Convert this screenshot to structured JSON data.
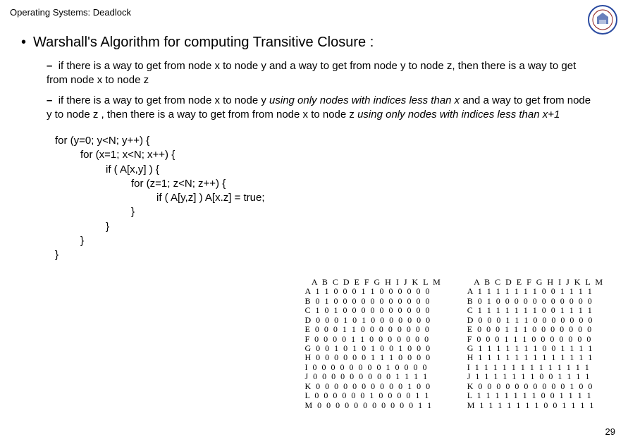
{
  "header": "Operating Systems: Deadlock",
  "title": "Warshall's Algorithm for computing Transitive Closure :",
  "bullets": [
    {
      "pre": "if there is a way to get from node x to node y and a way to get from node y to node z, then there is a way to get from node x to node z",
      "italic": "",
      "post": ""
    },
    {
      "pre": "if there is a way to get from node x to node y ",
      "italic1": "using only nodes with indices less than x",
      "mid": " and a way to get from node y to node z , then there is a way to get from from node x to node z ",
      "italic2": "using only nodes with indices less than x+1",
      "post": ""
    }
  ],
  "code": {
    "l1": "for (y=0; y<N; y++) {",
    "l2": "for (x=1; x<N; x++) {",
    "l3": "if ( A[x,y] ) {",
    "l4": "for (z=1; z<N; z++) {",
    "l5": "if ( A[y,z] ) A[x.z] = true;",
    "l6": "}",
    "l7": "}",
    "l8": "}",
    "l9": "}"
  },
  "chart_data": [
    {
      "type": "table",
      "title": "Adjacency matrix (before)",
      "columns": [
        "A",
        "B",
        "C",
        "D",
        "E",
        "F",
        "G",
        "H",
        "I",
        "J",
        "K",
        "L",
        "M"
      ],
      "rows": [
        "A",
        "B",
        "C",
        "D",
        "E",
        "F",
        "G",
        "H",
        "I",
        "J",
        "K",
        "L",
        "M"
      ],
      "values": [
        [
          1,
          1,
          0,
          0,
          0,
          1,
          1,
          0,
          0,
          0,
          0,
          0,
          0
        ],
        [
          0,
          1,
          0,
          0,
          0,
          0,
          0,
          0,
          0,
          0,
          0,
          0,
          0
        ],
        [
          1,
          0,
          1,
          0,
          0,
          0,
          0,
          0,
          0,
          0,
          0,
          0,
          0
        ],
        [
          0,
          0,
          0,
          1,
          0,
          1,
          0,
          0,
          0,
          0,
          0,
          0,
          0
        ],
        [
          0,
          0,
          0,
          1,
          1,
          0,
          0,
          0,
          0,
          0,
          0,
          0,
          0
        ],
        [
          0,
          0,
          0,
          0,
          1,
          1,
          0,
          0,
          0,
          0,
          0,
          0,
          0
        ],
        [
          0,
          0,
          1,
          0,
          1,
          0,
          1,
          0,
          0,
          1,
          0,
          0,
          0
        ],
        [
          0,
          0,
          0,
          0,
          0,
          0,
          1,
          1,
          1,
          0,
          0,
          0,
          0
        ],
        [
          0,
          0,
          0,
          0,
          0,
          0,
          0,
          0,
          1,
          0,
          0,
          0,
          0
        ],
        [
          0,
          0,
          0,
          0,
          0,
          0,
          0,
          0,
          0,
          1,
          1,
          1,
          1
        ],
        [
          0,
          0,
          0,
          0,
          0,
          0,
          0,
          0,
          0,
          0,
          1,
          0,
          0
        ],
        [
          0,
          0,
          0,
          0,
          0,
          0,
          1,
          0,
          0,
          0,
          0,
          1,
          1
        ],
        [
          0,
          0,
          0,
          0,
          0,
          0,
          0,
          0,
          0,
          0,
          0,
          1,
          1
        ]
      ]
    },
    {
      "type": "table",
      "title": "Transitive closure (after)",
      "columns": [
        "A",
        "B",
        "C",
        "D",
        "E",
        "F",
        "G",
        "H",
        "I",
        "J",
        "K",
        "L",
        "M"
      ],
      "rows": [
        "A",
        "B",
        "C",
        "D",
        "E",
        "F",
        "G",
        "H",
        "I",
        "J",
        "K",
        "L",
        "M"
      ],
      "values": [
        [
          1,
          1,
          1,
          1,
          1,
          1,
          1,
          0,
          0,
          1,
          1,
          1,
          1
        ],
        [
          0,
          1,
          0,
          0,
          0,
          0,
          0,
          0,
          0,
          0,
          0,
          0,
          0
        ],
        [
          1,
          1,
          1,
          1,
          1,
          1,
          1,
          0,
          0,
          1,
          1,
          1,
          1
        ],
        [
          0,
          0,
          0,
          1,
          1,
          1,
          0,
          0,
          0,
          0,
          0,
          0,
          0
        ],
        [
          0,
          0,
          0,
          1,
          1,
          1,
          0,
          0,
          0,
          0,
          0,
          0,
          0
        ],
        [
          0,
          0,
          0,
          1,
          1,
          1,
          0,
          0,
          0,
          0,
          0,
          0,
          0
        ],
        [
          1,
          1,
          1,
          1,
          1,
          1,
          1,
          0,
          0,
          1,
          1,
          1,
          1
        ],
        [
          1,
          1,
          1,
          1,
          1,
          1,
          1,
          1,
          1,
          1,
          1,
          1,
          1
        ],
        [
          1,
          1,
          1,
          1,
          1,
          1,
          1,
          1,
          1,
          1,
          1,
          1,
          1
        ],
        [
          1,
          1,
          1,
          1,
          1,
          1,
          1,
          0,
          0,
          1,
          1,
          1,
          1
        ],
        [
          0,
          0,
          0,
          0,
          0,
          0,
          0,
          0,
          0,
          0,
          1,
          0,
          0
        ],
        [
          1,
          1,
          1,
          1,
          1,
          1,
          1,
          0,
          0,
          1,
          1,
          1,
          1
        ],
        [
          1,
          1,
          1,
          1,
          1,
          1,
          1,
          0,
          0,
          1,
          1,
          1,
          1
        ]
      ]
    }
  ],
  "page_number": "29"
}
